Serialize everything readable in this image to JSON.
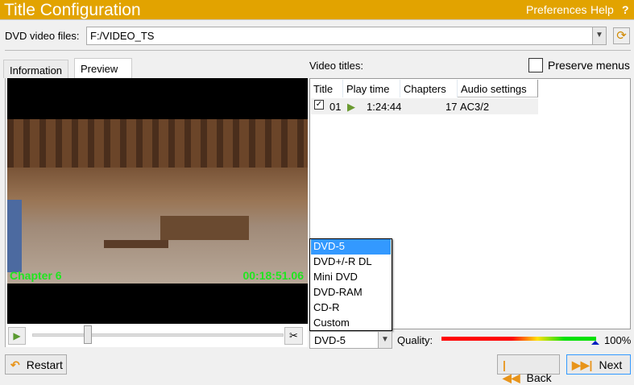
{
  "header": {
    "title": "Title Configuration",
    "preferences": "Preferences",
    "help": "Help",
    "help_icon": "?"
  },
  "files": {
    "label": "DVD video files:",
    "value": "F:/VIDEO_TS"
  },
  "tabs": [
    {
      "label": "Information"
    },
    {
      "label": "Preview"
    }
  ],
  "preview": {
    "chapter": "Chapter 6",
    "timecode": "00:18:51.06",
    "position": 0.25
  },
  "titles": {
    "label": "Video titles:",
    "preserve_menus": "Preserve menus",
    "preserve_checked": false,
    "columns": [
      "Title",
      "Play time",
      "Chapters",
      "Audio settings"
    ],
    "rows": [
      {
        "checked": true,
        "title": "01",
        "play_time": "1:24:44",
        "chapters": "17",
        "audio": "AC3/2"
      }
    ]
  },
  "disc": {
    "options": [
      "DVD-5",
      "DVD+/-R DL",
      "Mini DVD",
      "DVD-RAM",
      "CD-R",
      "Custom"
    ],
    "selected": "DVD-5"
  },
  "quality": {
    "label": "Quality:",
    "value": "100%"
  },
  "buttons": {
    "restart": "Restart",
    "back": "Back",
    "next": "Next"
  },
  "colors": {
    "header": "#e2a300",
    "overlay": "#1fe61f",
    "selection": "#3399ff"
  }
}
